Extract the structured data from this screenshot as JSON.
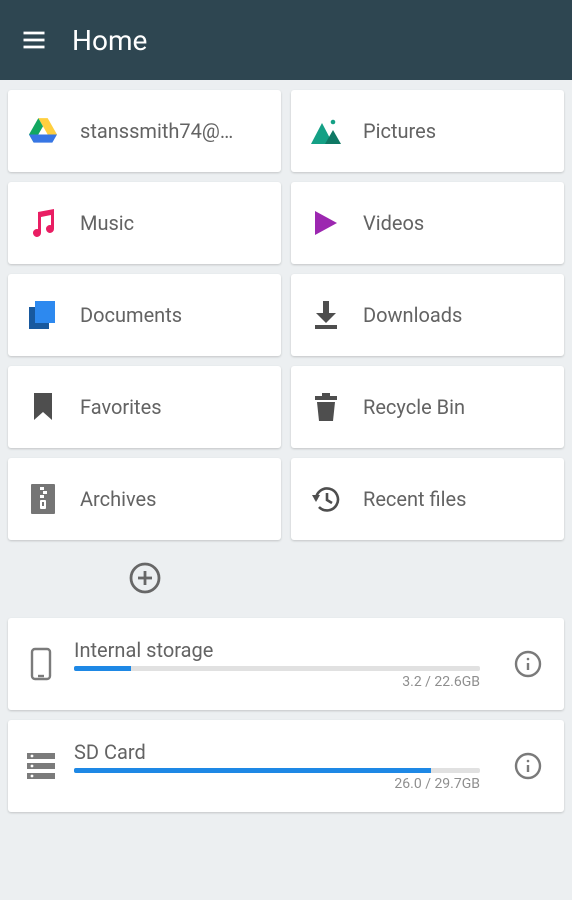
{
  "header": {
    "title": "Home"
  },
  "cards": [
    {
      "id": "drive",
      "label": "stanssmith74@…"
    },
    {
      "id": "pictures",
      "label": "Pictures"
    },
    {
      "id": "music",
      "label": "Music"
    },
    {
      "id": "videos",
      "label": "Videos"
    },
    {
      "id": "documents",
      "label": "Documents"
    },
    {
      "id": "downloads",
      "label": "Downloads"
    },
    {
      "id": "favorites",
      "label": "Favorites"
    },
    {
      "id": "recycle",
      "label": "Recycle Bin"
    },
    {
      "id": "archives",
      "label": "Archives"
    },
    {
      "id": "recent",
      "label": "Recent files"
    }
  ],
  "storage": [
    {
      "id": "internal",
      "name": "Internal storage",
      "usage": "3.2 / 22.6GB",
      "percent": 14
    },
    {
      "id": "sdcard",
      "name": "SD Card",
      "usage": "26.0 / 29.7GB",
      "percent": 88
    }
  ]
}
